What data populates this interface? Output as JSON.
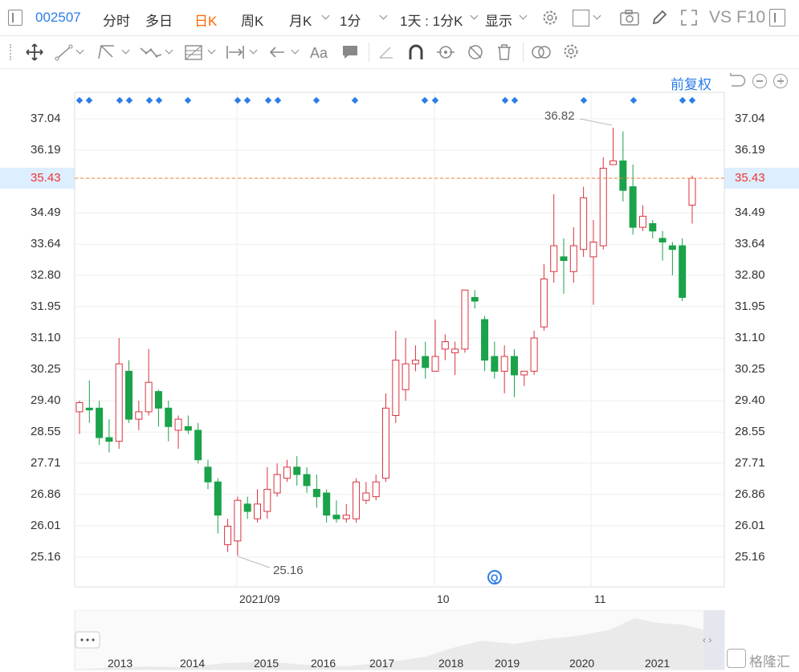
{
  "toolbar": {
    "code": "002507",
    "tabs": [
      "分时",
      "多日",
      "日K",
      "周K"
    ],
    "active_tab": "日K",
    "month": "月K",
    "minute": "1分",
    "period": "1天 : 1分K",
    "display": "显示",
    "vs": "VS",
    "f10": "F10"
  },
  "chart": {
    "adjust_label": "前复权",
    "y_ticks": [
      "37.04",
      "36.19",
      "35.43",
      "34.49",
      "33.64",
      "32.80",
      "31.95",
      "31.10",
      "30.25",
      "29.40",
      "28.55",
      "27.71",
      "26.86",
      "26.01",
      "25.16"
    ],
    "current_price": "35.43",
    "high_label": "36.82",
    "low_label": "25.16",
    "x_labels": [
      "2021/09",
      "10",
      "11"
    ],
    "overview_years": [
      "2013",
      "2014",
      "2015",
      "2016",
      "2017",
      "2018",
      "2019",
      "2020",
      "2021"
    ],
    "watermark": "格隆汇",
    "colors": {
      "up": "#d9333f",
      "down": "#1aa34a",
      "accent": "#2b7de9",
      "price_line": "#f07c2a"
    }
  },
  "chart_data": {
    "type": "candlestick",
    "y_min": 25.16,
    "y_max": 37.04,
    "candles": [
      [
        29.1,
        29.35,
        28.5,
        29.4
      ],
      [
        29.2,
        29.15,
        28.8,
        29.95
      ],
      [
        29.2,
        28.4,
        28.2,
        29.4
      ],
      [
        28.4,
        28.3,
        28.0,
        28.9
      ],
      [
        28.3,
        30.4,
        28.1,
        31.1
      ],
      [
        30.2,
        28.9,
        28.8,
        30.5
      ],
      [
        28.9,
        29.1,
        28.6,
        29.4
      ],
      [
        29.1,
        29.9,
        29.0,
        30.8
      ],
      [
        29.65,
        29.2,
        28.7,
        29.7
      ],
      [
        29.2,
        28.7,
        28.3,
        29.4
      ],
      [
        28.6,
        28.9,
        28.1,
        29.0
      ],
      [
        28.7,
        28.6,
        28.5,
        29.0
      ],
      [
        28.6,
        27.8,
        27.7,
        28.8
      ],
      [
        27.6,
        27.2,
        27.0,
        27.8
      ],
      [
        27.2,
        26.3,
        25.8,
        27.3
      ],
      [
        25.5,
        26.0,
        25.3,
        26.2
      ],
      [
        25.6,
        26.7,
        25.2,
        26.8
      ],
      [
        26.6,
        26.4,
        26.2,
        26.8
      ],
      [
        26.2,
        26.6,
        26.1,
        27.0
      ],
      [
        26.4,
        27.0,
        26.2,
        27.6
      ],
      [
        26.9,
        27.4,
        26.8,
        27.7
      ],
      [
        27.3,
        27.6,
        27.2,
        27.8
      ],
      [
        27.6,
        27.4,
        27.1,
        27.9
      ],
      [
        27.4,
        27.1,
        26.9,
        27.6
      ],
      [
        27.0,
        26.8,
        26.5,
        27.4
      ],
      [
        26.9,
        26.3,
        26.1,
        27.0
      ],
      [
        26.3,
        26.2,
        26.1,
        26.7
      ],
      [
        26.2,
        26.3,
        26.1,
        26.6
      ],
      [
        26.2,
        27.2,
        26.1,
        27.3
      ],
      [
        26.7,
        26.9,
        26.6,
        27.2
      ],
      [
        26.8,
        27.2,
        26.7,
        27.4
      ],
      [
        27.3,
        29.2,
        27.2,
        29.6
      ],
      [
        29.0,
        30.5,
        28.8,
        31.3
      ],
      [
        29.7,
        30.4,
        29.4,
        31.1
      ],
      [
        30.4,
        30.5,
        30.2,
        30.9
      ],
      [
        30.6,
        30.3,
        30.0,
        31.0
      ],
      [
        30.2,
        30.6,
        30.2,
        31.6
      ],
      [
        30.8,
        31.0,
        30.5,
        31.2
      ],
      [
        30.7,
        30.8,
        30.1,
        31.0
      ],
      [
        30.8,
        32.4,
        30.7,
        32.4
      ],
      [
        32.2,
        32.1,
        31.9,
        32.4
      ],
      [
        31.6,
        30.5,
        30.2,
        31.7
      ],
      [
        30.6,
        30.2,
        30.0,
        31.0
      ],
      [
        30.2,
        30.6,
        29.6,
        30.9
      ],
      [
        30.6,
        30.1,
        29.5,
        30.8
      ],
      [
        30.1,
        30.2,
        29.8,
        30.2
      ],
      [
        30.2,
        31.1,
        30.1,
        31.3
      ],
      [
        31.4,
        32.7,
        31.3,
        33.1
      ],
      [
        32.9,
        33.6,
        32.6,
        35.0
      ],
      [
        33.3,
        33.2,
        32.3,
        33.8
      ],
      [
        32.9,
        33.6,
        32.6,
        34.1
      ],
      [
        33.5,
        34.9,
        33.3,
        35.2
      ],
      [
        33.3,
        33.7,
        32.0,
        34.3
      ],
      [
        33.6,
        35.7,
        33.5,
        36.0
      ],
      [
        35.8,
        35.9,
        35.8,
        36.8
      ],
      [
        35.9,
        35.1,
        34.8,
        36.7
      ],
      [
        35.2,
        34.1,
        33.9,
        35.8
      ],
      [
        34.1,
        34.4,
        34.0,
        34.7
      ],
      [
        34.2,
        34.0,
        33.8,
        34.3
      ],
      [
        33.8,
        33.7,
        33.2,
        34.0
      ],
      [
        33.6,
        33.5,
        32.8,
        33.7
      ],
      [
        33.6,
        32.2,
        32.1,
        33.8
      ],
      [
        34.7,
        35.43,
        34.2,
        35.5
      ]
    ]
  }
}
